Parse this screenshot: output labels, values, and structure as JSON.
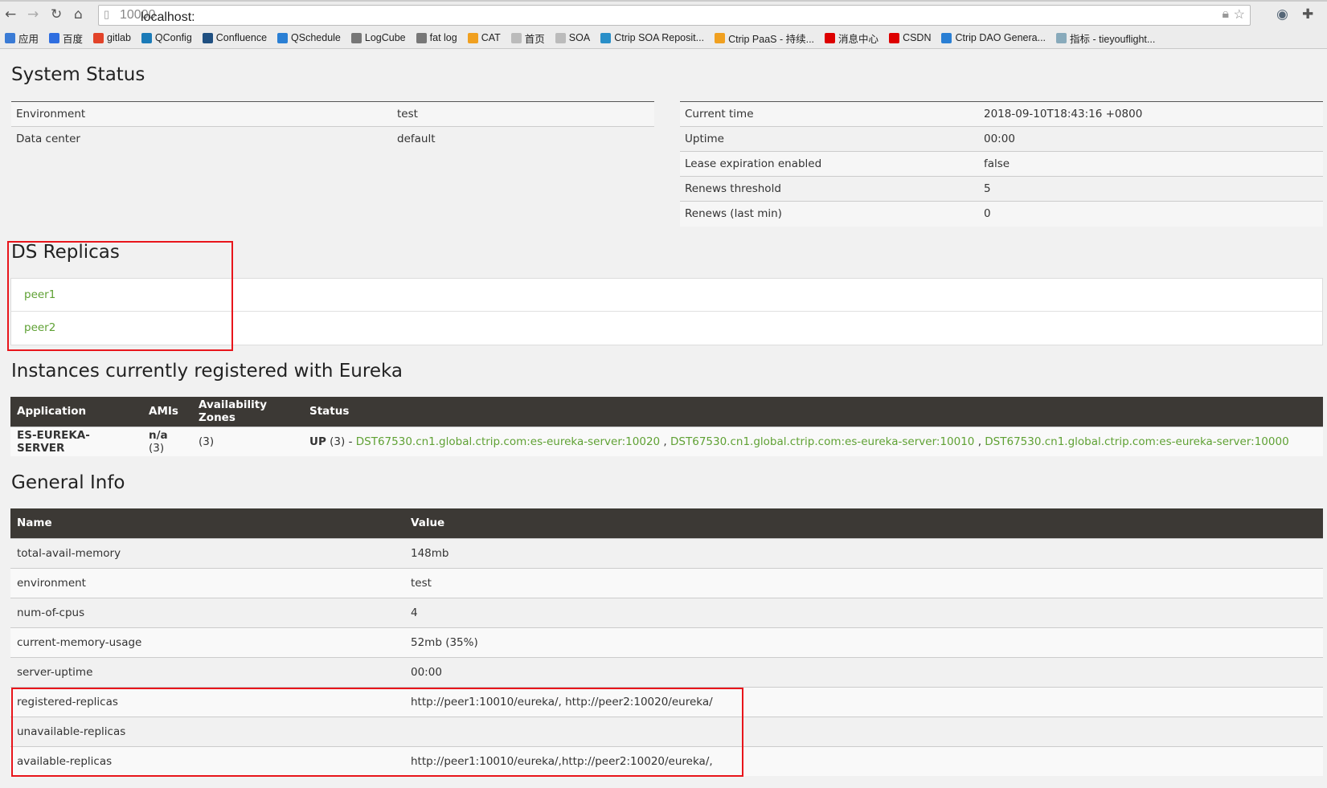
{
  "browser": {
    "url_host": "localhost:",
    "url_port": "10000",
    "bookmarks": [
      {
        "label": "应用",
        "icon": "apps-icon",
        "color": "#3a7bd5"
      },
      {
        "label": "百度",
        "icon": "baidu-icon",
        "color": "#2f6ee0"
      },
      {
        "label": "gitlab",
        "icon": "gitlab-icon",
        "color": "#e24329"
      },
      {
        "label": "QConfig",
        "icon": "qconfig-icon",
        "color": "#1b7bb8"
      },
      {
        "label": "Confluence",
        "icon": "confluence-icon",
        "color": "#205081"
      },
      {
        "label": "QSchedule",
        "icon": "qschedule-icon",
        "color": "#2a7fd4"
      },
      {
        "label": "LogCube",
        "icon": "logcube-icon",
        "color": "#777"
      },
      {
        "label": "fat log",
        "icon": "fatlog-icon",
        "color": "#777"
      },
      {
        "label": "CAT",
        "icon": "cat-icon",
        "color": "#f0a020"
      },
      {
        "label": "首页",
        "icon": "page-icon",
        "color": "#bbb"
      },
      {
        "label": "SOA",
        "icon": "page-icon",
        "color": "#bbb"
      },
      {
        "label": "Ctrip SOA Reposit...",
        "icon": "ctrip-soa-icon",
        "color": "#2a8fc8"
      },
      {
        "label": "Ctrip PaaS - 持续...",
        "icon": "paas-icon",
        "color": "#f0a020"
      },
      {
        "label": "消息中心",
        "icon": "c-icon",
        "color": "#d00"
      },
      {
        "label": "CSDN",
        "icon": "csdn-icon",
        "color": "#d00"
      },
      {
        "label": "Ctrip DAO Genera...",
        "icon": "dao-icon",
        "color": "#2a7fd4"
      },
      {
        "label": "指标 - tieyouflight...",
        "icon": "signal-icon",
        "color": "#8ab"
      }
    ]
  },
  "system_status": {
    "title": "System Status",
    "left": [
      {
        "k": "Environment",
        "v": "test"
      },
      {
        "k": "Data center",
        "v": "default"
      }
    ],
    "right": [
      {
        "k": "Current time",
        "v": "2018-09-10T18:43:16 +0800"
      },
      {
        "k": "Uptime",
        "v": "00:00"
      },
      {
        "k": "Lease expiration enabled",
        "v": "false"
      },
      {
        "k": "Renews threshold",
        "v": "5"
      },
      {
        "k": "Renews (last min)",
        "v": "0"
      }
    ]
  },
  "replicas": {
    "title": "DS Replicas",
    "items": [
      "peer1",
      "peer2"
    ]
  },
  "instances": {
    "title": "Instances currently registered with Eureka",
    "headers": [
      "Application",
      "AMIs",
      "Availability Zones",
      "Status"
    ],
    "row": {
      "app": "ES-EUREKA-SERVER",
      "amis": "n/a",
      "amis_count": "(3)",
      "zones": "(3)",
      "status": "UP",
      "status_count": "(3)",
      "status_sep": " - ",
      "links": [
        "DST67530.cn1.global.ctrip.com:es-eureka-server:10020",
        "DST67530.cn1.global.ctrip.com:es-eureka-server:10010",
        "DST67530.cn1.global.ctrip.com:es-eureka-server:10000"
      ]
    }
  },
  "general": {
    "title": "General Info",
    "headers": [
      "Name",
      "Value"
    ],
    "rows": [
      {
        "k": "total-avail-memory",
        "v": "148mb"
      },
      {
        "k": "environment",
        "v": "test"
      },
      {
        "k": "num-of-cpus",
        "v": "4"
      },
      {
        "k": "current-memory-usage",
        "v": "52mb (35%)"
      },
      {
        "k": "server-uptime",
        "v": "00:00"
      },
      {
        "k": "registered-replicas",
        "v": "http://peer1:10010/eureka/, http://peer2:10020/eureka/"
      },
      {
        "k": "unavailable-replicas",
        "v": ""
      },
      {
        "k": "available-replicas",
        "v": "http://peer1:10010/eureka/,http://peer2:10020/eureka/,"
      }
    ]
  },
  "colors": {
    "link": "#5fa134",
    "header": "#3c3935",
    "highlight": "#e8151b"
  }
}
